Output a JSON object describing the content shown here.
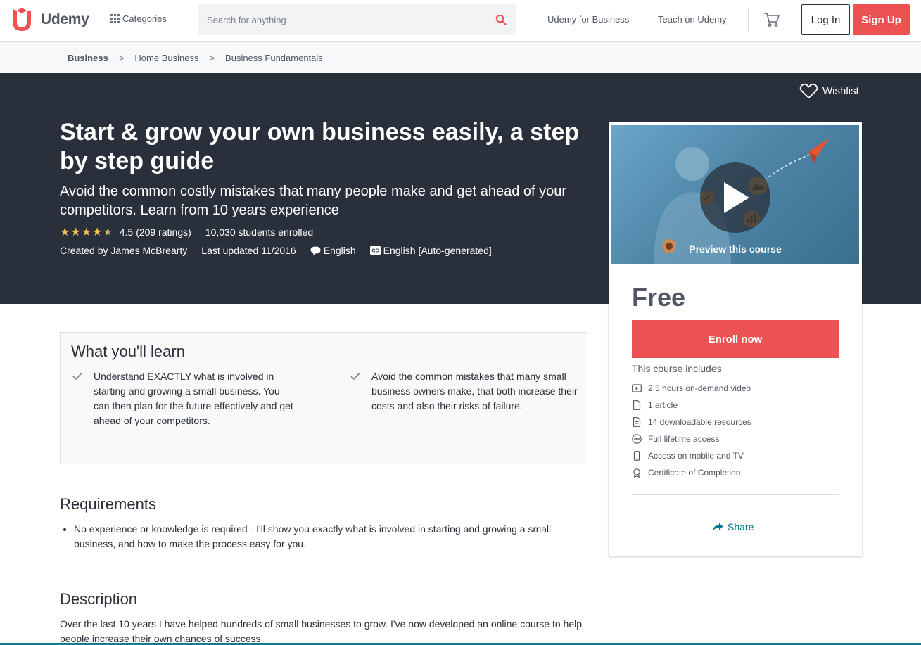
{
  "header": {
    "logo_text": "Udemy",
    "categories_label": "Categories",
    "search_placeholder": "Search for anything",
    "nav_business": "Udemy for Business",
    "nav_teach": "Teach on Udemy",
    "login_label": "Log In",
    "signup_label": "Sign Up",
    "brand_color": "#ec5252"
  },
  "breadcrumb": [
    "Business",
    "Home Business",
    "Business Fundamentals"
  ],
  "hero": {
    "wishlist_label": "Wishlist",
    "title": "Start & grow your own business easily, a step by step guide",
    "subtitle": "Avoid the common costly mistakes that many people make and get ahead of your competitors. Learn from 10 years experience",
    "rating_value": "4.5",
    "rating_count": "(209 ratings)",
    "students": "10,030 students enrolled",
    "created_by": "Created by James McBrearty",
    "last_updated": "Last updated 11/2016",
    "language": "English",
    "captions": "English [Auto-generated]",
    "background": "#29303b"
  },
  "card": {
    "preview_label": "Preview this course",
    "price": "Free",
    "enroll_label": "Enroll now",
    "includes_title": "This course includes",
    "includes": [
      {
        "icon": "video-icon",
        "label": "2.5 hours on-demand video"
      },
      {
        "icon": "article-icon",
        "label": "1 article"
      },
      {
        "icon": "file-icon",
        "label": "14 downloadable resources"
      },
      {
        "icon": "infinity-icon",
        "label": "Full lifetime access"
      },
      {
        "icon": "mobile-icon",
        "label": "Access on mobile and TV"
      },
      {
        "icon": "certificate-icon",
        "label": "Certificate of Completion"
      }
    ],
    "share_label": "Share"
  },
  "learn": {
    "title": "What you'll learn",
    "items": [
      "Understand EXACTLY what is involved in starting and growing a small business. You can then plan for the future effectively and get ahead of your competitors.",
      "Avoid the common mistakes that many small business owners make, that both increase their costs and also their risks of failure."
    ]
  },
  "requirements": {
    "title": "Requirements",
    "items": [
      "No experience or knowledge is required - I'll show you exactly what is involved in starting and growing a small business, and how to make the process easy for you."
    ]
  },
  "description": {
    "title": "Description",
    "text": "Over the last 10 years I have helped hundreds of small businesses to grow. I've now developed an online course to help people increase their own chances of success."
  }
}
